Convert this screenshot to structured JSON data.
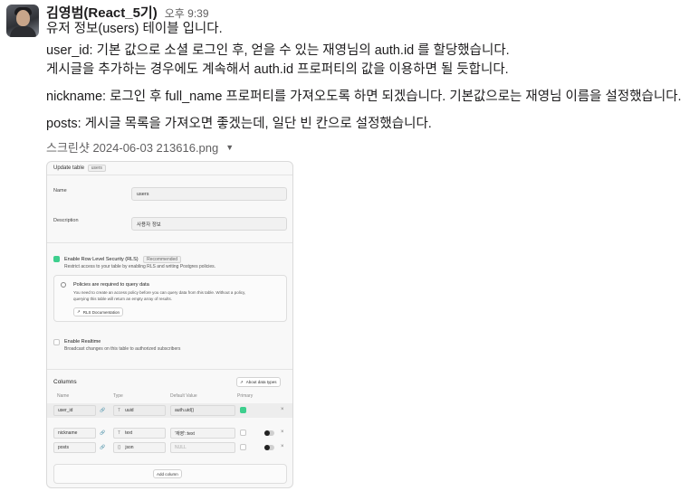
{
  "message": {
    "sender": "김영범(React_5기)",
    "time": "오후 9:39",
    "lines": [
      "유저 정보(users) 테이블 입니다.",
      "user_id: 기본 값으로 소셜 로그인 후, 얻을 수 있는 재영님의 auth.id 를 할당했습니다.",
      "게시글을 추가하는 경우에도 계속해서 auth.id 프로퍼티의 값을 이용하면 될 듯합니다.",
      "nickname: 로그인 후 full_name 프로퍼티를 가져오도록 하면 되겠습니다. 기본값으로는 재영님 이름을 설정했습니다.",
      "posts: 게시글 목록을 가져오면 좋겠는데, 일단 빈 칸으로 설정했습니다."
    ]
  },
  "attachment": {
    "filename": "스크린샷 2024-06-03 213616.png",
    "caret_icon": "caret-down-icon"
  },
  "screenshot": {
    "title": "Update table",
    "table_chip": "users",
    "name_label": "Name",
    "name_value": "users",
    "description_label": "Description",
    "description_value": "사용자 정보",
    "rls": {
      "label": "Enable Row Level Security (RLS)",
      "badge": "Recommended",
      "desc": "Restrict access to your table by enabling RLS and writing Postgres policies.",
      "checked": true
    },
    "policy": {
      "title": "Policies are required to query data",
      "desc1": "You need to create an access policy before you can query data from this table. Without a policy,",
      "desc2": "querying this table will return an empty array of results.",
      "button": "RLS Documentation"
    },
    "realtime": {
      "label": "Enable Realtime",
      "desc": "Broadcast changes on this table to authorized subscribers",
      "checked": false
    },
    "columns_label": "Columns",
    "about_button": "About data types",
    "headers": [
      "Name",
      "Type",
      "Default Value",
      "Primary"
    ],
    "rows": [
      {
        "name": "user_id",
        "type": "uuid",
        "default": "auth.uid()",
        "primary": true
      },
      {
        "name": "nickname",
        "type": "text",
        "default": "'재영'::text",
        "primary": false
      },
      {
        "name": "posts",
        "type": "json",
        "default": "NULL",
        "primary": false
      }
    ],
    "add_column": "Add column",
    "accent_color": "#3ecf8e"
  }
}
